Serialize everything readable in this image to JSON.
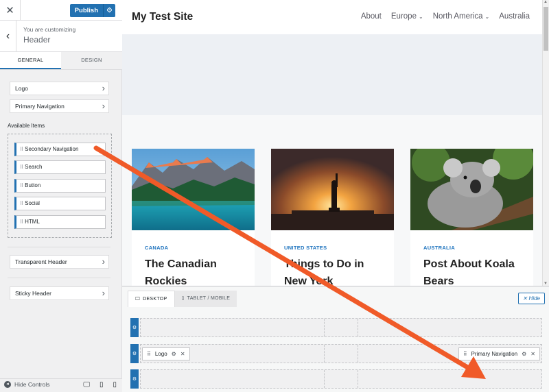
{
  "sidebar": {
    "publish_label": "Publish",
    "customizing_label": "You are customizing",
    "section_title": "Header",
    "tabs": [
      {
        "label": "GENERAL",
        "active": true
      },
      {
        "label": "DESIGN",
        "active": false
      }
    ],
    "items": [
      "Logo",
      "Primary Navigation"
    ],
    "available_label": "Available Items",
    "available_items": [
      "Secondary Navigation",
      "Search",
      "Button",
      "Social",
      "HTML"
    ],
    "transparent_header": "Transparent Header",
    "sticky_header": "Sticky Header",
    "hide_controls": "Hide Controls"
  },
  "site": {
    "title": "My Test Site",
    "nav": [
      {
        "label": "About",
        "dropdown": false
      },
      {
        "label": "Europe",
        "dropdown": true
      },
      {
        "label": "North America",
        "dropdown": true
      },
      {
        "label": "Australia",
        "dropdown": false
      }
    ],
    "posts": [
      {
        "category": "CANADA",
        "title": "The Canadian Rockies"
      },
      {
        "category": "UNITED STATES",
        "title": "Things to Do in New York"
      },
      {
        "category": "AUSTRALIA",
        "title": "Post About Koala Bears"
      }
    ]
  },
  "builder": {
    "tabs": [
      {
        "label": "DESKTOP",
        "active": true
      },
      {
        "label": "TABLET / MOBILE",
        "active": false
      }
    ],
    "hide_label": "Hide",
    "logo_chip": "Logo",
    "nav_chip": "Primary Navigation"
  },
  "colors": {
    "accent": "#2271b1",
    "arrow": "#f05a28",
    "link": "#1e73be"
  }
}
